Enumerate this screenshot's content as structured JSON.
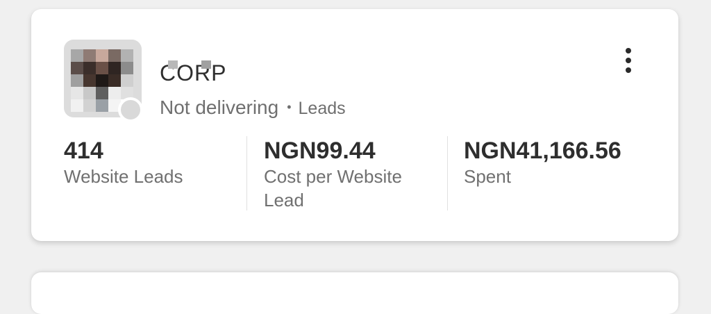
{
  "campaign": {
    "name": "CORP",
    "status": "Not delivering",
    "separator": "•",
    "objective": "Leads"
  },
  "metrics": [
    {
      "value": "414",
      "label": "Website Leads"
    },
    {
      "value": "NGN99.44",
      "label": "Cost per Website Lead"
    },
    {
      "value": "NGN41,166.56",
      "label": "Spent"
    }
  ],
  "icons": {
    "more": "more-vertical-icon",
    "avatar": "company-logo",
    "presence": "status-dot"
  },
  "colors": {
    "card_bg": "#ffffff",
    "page_bg": "#f0f0f0",
    "status_dot": "#d9d9d9",
    "text_primary": "#2e2e2e",
    "text_secondary": "#707070"
  }
}
